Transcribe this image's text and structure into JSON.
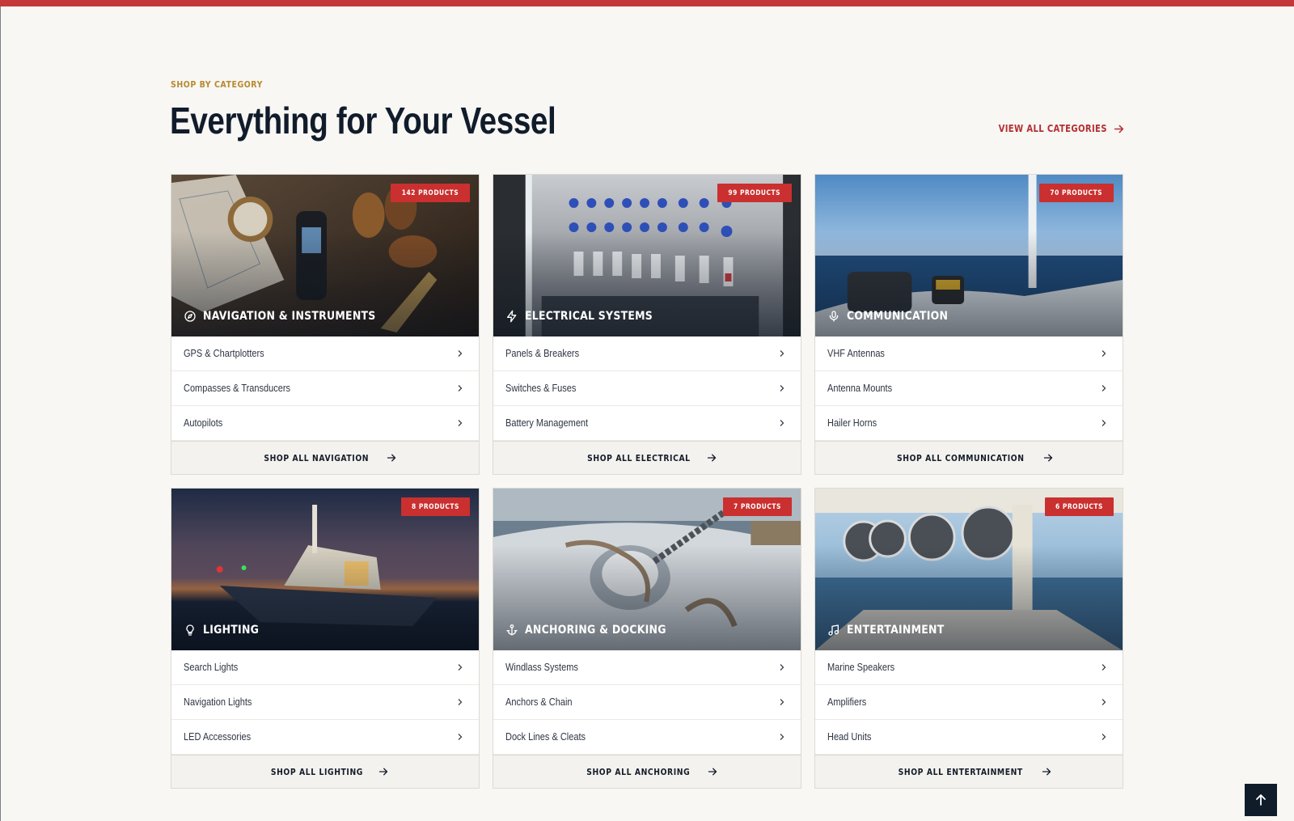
{
  "section": {
    "eyebrow": "SHOP BY CATEGORY",
    "title": "Everything for Your Vessel",
    "view_all_label": "VIEW ALL CATEGORIES"
  },
  "colors": {
    "accent": "#c4383a",
    "badge": "#c9302f",
    "eyebrow": "#b8892f",
    "ink": "#111c2b",
    "background": "#f8f7f4"
  },
  "categories": [
    {
      "name": "NAVIGATION & INSTRUMENTS",
      "icon": "compass-icon",
      "badge": "142 PRODUCTS",
      "links": [
        "GPS & Chartplotters",
        "Compasses & Transducers",
        "Autopilots"
      ],
      "shop_all": "SHOP ALL NAVIGATION"
    },
    {
      "name": "ELECTRICAL SYSTEMS",
      "icon": "lightning-icon",
      "badge": "99 PRODUCTS",
      "links": [
        "Panels & Breakers",
        "Switches & Fuses",
        "Battery Management"
      ],
      "shop_all": "SHOP ALL ELECTRICAL"
    },
    {
      "name": "COMMUNICATION",
      "icon": "microphone-icon",
      "badge": "70 PRODUCTS",
      "links": [
        "VHF Antennas",
        "Antenna Mounts",
        "Hailer Horns"
      ],
      "shop_all": "SHOP ALL COMMUNICATION"
    },
    {
      "name": "LIGHTING",
      "icon": "lightbulb-icon",
      "badge": "8 PRODUCTS",
      "links": [
        "Search Lights",
        "Navigation Lights",
        "LED Accessories"
      ],
      "shop_all": "SHOP ALL LIGHTING"
    },
    {
      "name": "ANCHORING & DOCKING",
      "icon": "anchor-icon",
      "badge": "7 PRODUCTS",
      "links": [
        "Windlass Systems",
        "Anchors & Chain",
        "Dock Lines & Cleats"
      ],
      "shop_all": "SHOP ALL ANCHORING"
    },
    {
      "name": "ENTERTAINMENT",
      "icon": "music-note-icon",
      "badge": "6 PRODUCTS",
      "links": [
        "Marine Speakers",
        "Amplifiers",
        "Head Units"
      ],
      "shop_all": "SHOP ALL ENTERTAINMENT"
    }
  ],
  "back_to_top_icon": "arrow-up-icon"
}
